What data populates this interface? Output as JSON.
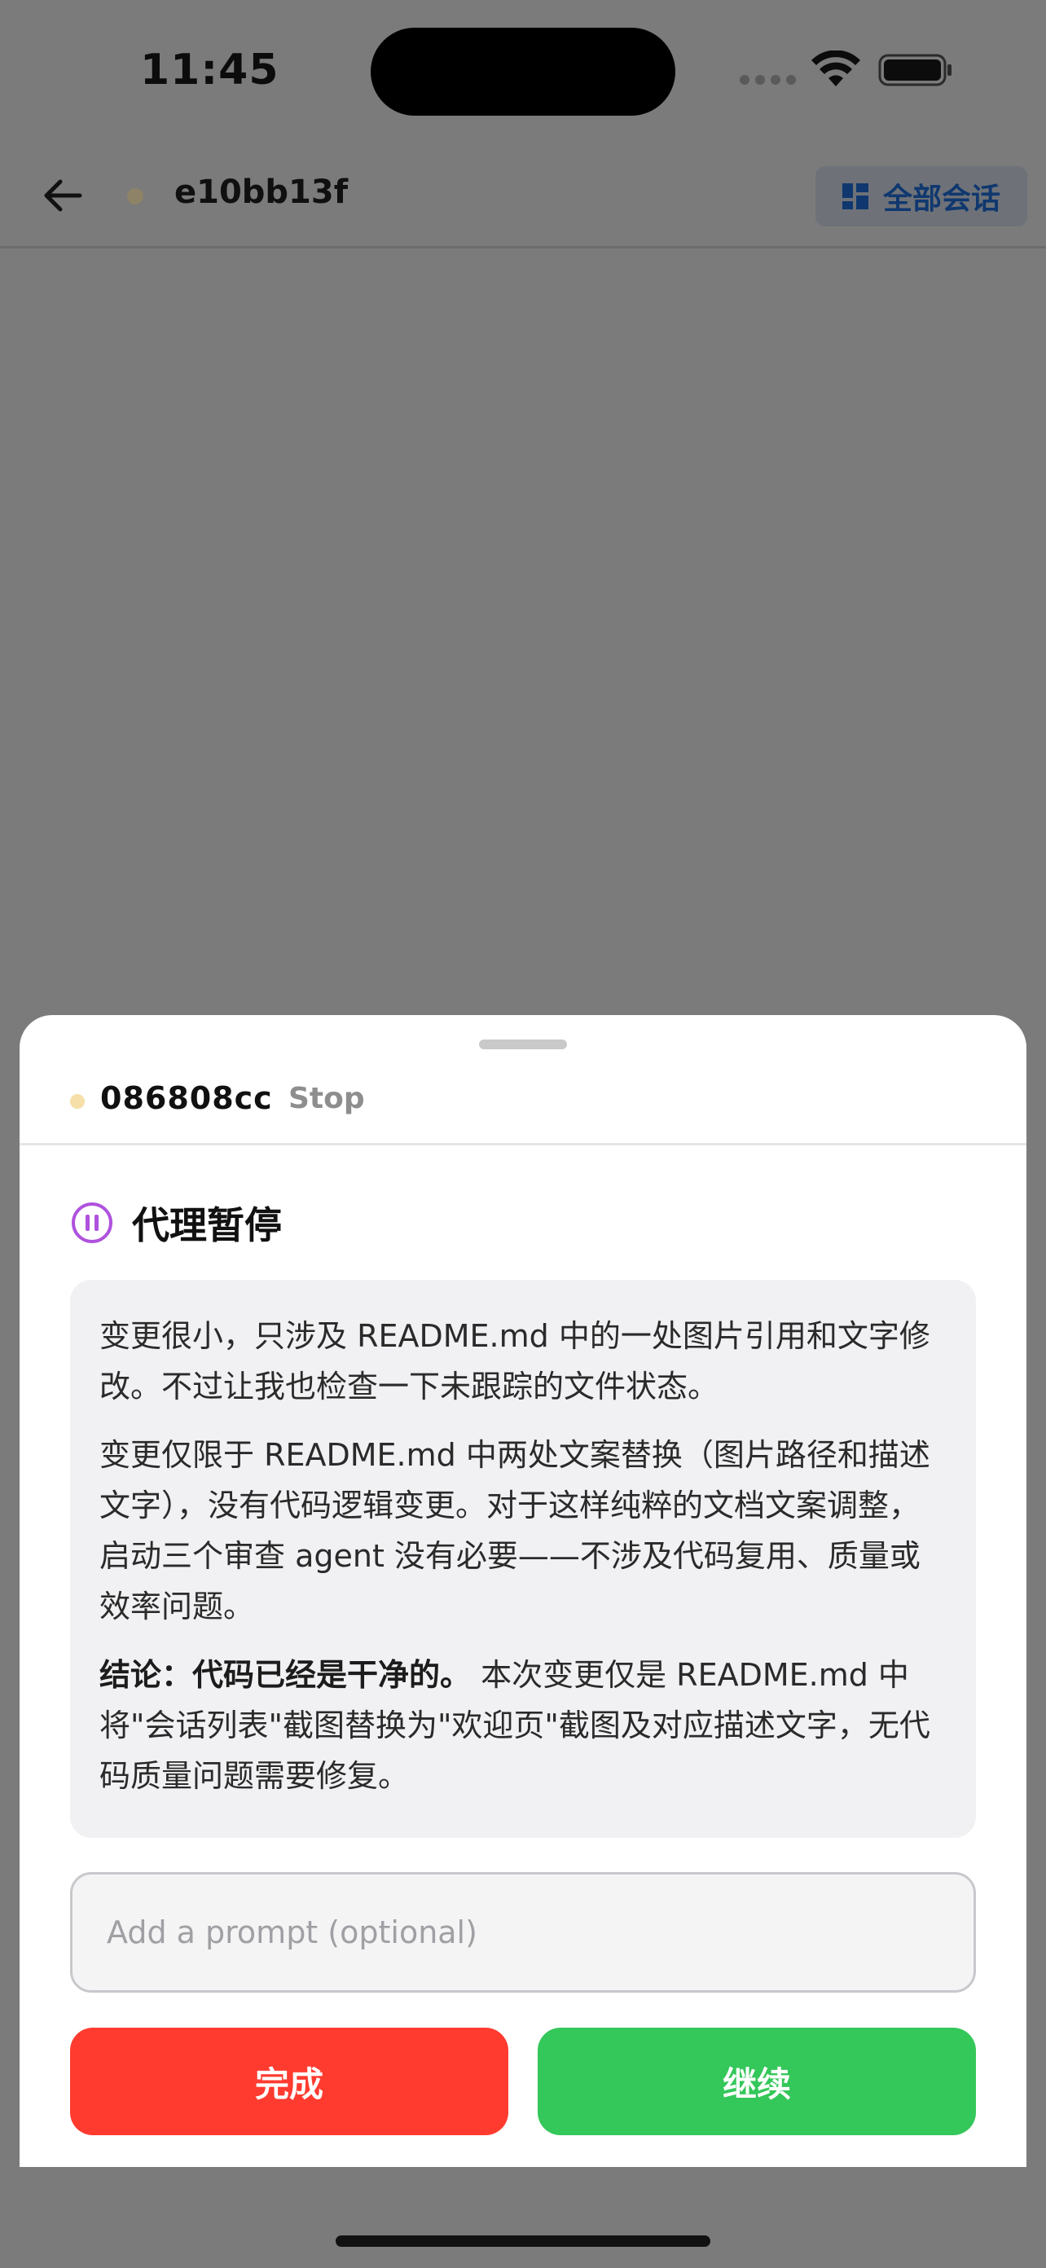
{
  "status_bar": {
    "time": "11:45",
    "icons": [
      "cellular-signal-icon",
      "wifi-icon",
      "battery-icon"
    ]
  },
  "header": {
    "back_icon": "arrow-left-icon",
    "session_id": "e10bb13f",
    "all_sessions_label": "全部会话",
    "all_sessions_icon": "grid-icon"
  },
  "sheet": {
    "agent_id": "086808cc",
    "agent_status": "Stop",
    "pause_title": "代理暂停",
    "pause_icon": "pause-circle-icon",
    "message": {
      "para1": "变更很小，只涉及 README.md 中的一处图片引用和文字修改。不过让我也检查一下未跟踪的文件状态。",
      "para2": "变更仅限于 README.md 中两处文案替换（图片路径和描述文字），没有代码逻辑变更。对于这样纯粹的文档文案调整，启动三个审查 agent 没有必要——不涉及代码复用、质量或效率问题。",
      "para3_bold": "结论：代码已经是干净的。",
      "para3_rest": " 本次变更仅是 README.md 中将\"会话列表\"截图替换为\"欢迎页\"截图及对应描述文字，无代码质量问题需要修复。"
    },
    "prompt": {
      "placeholder": "Add a prompt (optional)",
      "value": ""
    },
    "done_label": "完成",
    "continue_label": "继续"
  },
  "colors": {
    "done": "#ff3b30",
    "continue": "#34c759",
    "pause_icon": "#af52de",
    "agent_dot": "#f6dfa8",
    "link_blue": "#10386f"
  }
}
